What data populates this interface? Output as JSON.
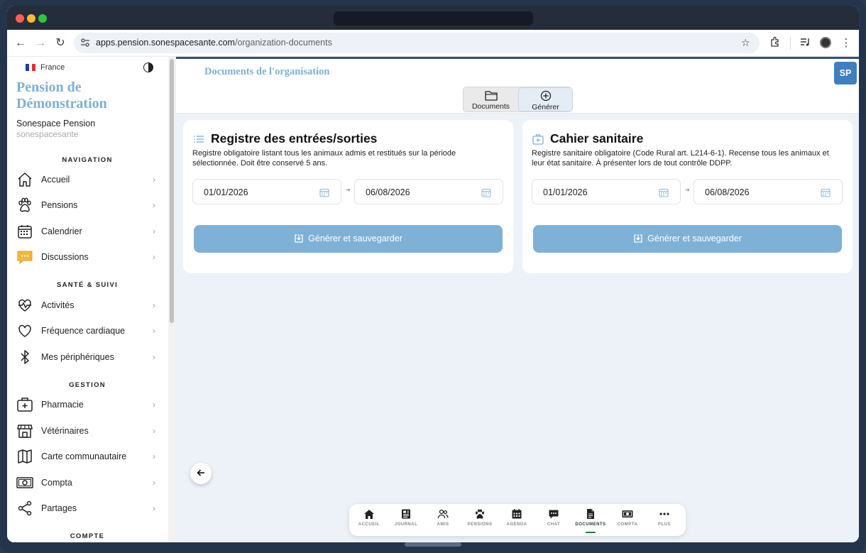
{
  "browser": {
    "url_host": "apps.pension.sonespacesante.com",
    "url_path": "/organization-documents"
  },
  "sidebar": {
    "country": "France",
    "org_name": "Pension de Démonstration",
    "org_subtitle": "Sonespace Pension",
    "org_handle": "sonespacesante",
    "sections": {
      "navigation": "NAVIGATION",
      "sante": "SANTÉ & SUIVI",
      "gestion": "GESTION",
      "compte": "COMPTE"
    },
    "items": {
      "accueil": "Accueil",
      "pensions": "Pensions",
      "calendrier": "Calendrier",
      "discussions": "Discussions",
      "activites": "Activités",
      "frequence": "Fréquence cardiaque",
      "peripheriques": "Mes périphériques",
      "pharmacie": "Pharmacie",
      "veterinaires": "Vétérinaires",
      "carte": "Carte communautaire",
      "compta": "Compta",
      "partages": "Partages"
    }
  },
  "header": {
    "title": "Documents de l'organisation",
    "user_initials": "SP",
    "segments": {
      "documents": "Documents",
      "generer": "Générer"
    }
  },
  "cards": {
    "registre": {
      "title": "Registre des entrées/sorties",
      "description": "Registre obligatoire listant tous les animaux admis et restitués sur la période sélectionnée. Doit être conservé 5 ans.",
      "date_from": "01/01/2026",
      "date_to": "06/08/2026",
      "button": "Générer et sauvegarder"
    },
    "cahier": {
      "title": "Cahier sanitaire",
      "description": "Registre sanitaire obligatoire (Code Rural art. L214-6-1). Recense tous les animaux et leur état sanitaire. À présenter lors de tout contrôle DDPP.",
      "date_from": "01/01/2026",
      "date_to": "06/08/2026",
      "button": "Générer et sauvegarder"
    }
  },
  "bottom_nav": {
    "accueil": "ACCUEIL",
    "journal": "JOURNAL",
    "amis": "AMIS",
    "pensions": "PENSIONS",
    "agenda": "AGENDA",
    "chat": "CHAT",
    "documents": "DOCUMENTS",
    "compta": "COMPTA",
    "plus": "PLUS"
  },
  "colors": {
    "accent": "#7fb0d4",
    "button": "#7fb1d6",
    "badge": "#3d7fc1",
    "active_nav": "#1e7a3a"
  }
}
